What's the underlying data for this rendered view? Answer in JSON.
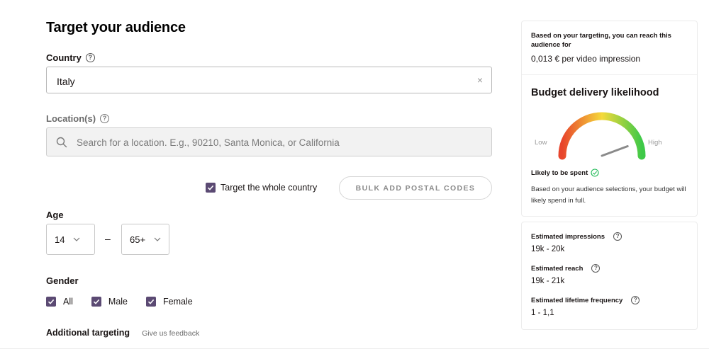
{
  "page": {
    "title": "Target your audience"
  },
  "country": {
    "label": "Country",
    "value": "Italy"
  },
  "location": {
    "label": "Location(s)",
    "placeholder": "Search for a location. E.g., 90210, Santa Monica, or California"
  },
  "whole_country": {
    "label": "Target the whole country",
    "checked": true
  },
  "bulk_button": {
    "label": "BULK ADD POSTAL CODES"
  },
  "age": {
    "label": "Age",
    "min": "14",
    "max": "65+",
    "separator": "–"
  },
  "gender": {
    "label": "Gender",
    "options": [
      {
        "label": "All",
        "checked": true
      },
      {
        "label": "Male",
        "checked": true
      },
      {
        "label": "Female",
        "checked": true
      }
    ]
  },
  "additional": {
    "title": "Additional targeting",
    "link": "Give us feedback"
  },
  "reach_card": {
    "intro": "Based on your targeting, you can reach this audience for",
    "price": "0,013 € per video impression"
  },
  "budget": {
    "title": "Budget delivery likelihood",
    "low_label": "Low",
    "high_label": "High",
    "gauge_level": 0.78,
    "status": "Likely to be spent",
    "description": "Based on your audience selections, your budget will likely spend in full.",
    "status_color": "#1db954"
  },
  "estimates": [
    {
      "label": "Estimated impressions",
      "value": "19k - 20k"
    },
    {
      "label": "Estimated reach",
      "value": "19k - 21k"
    },
    {
      "label": "Estimated lifetime frequency",
      "value": "1 - 1,1"
    }
  ],
  "colors": {
    "checkbox": "#5b4a73",
    "gauge_low": "#e8452c",
    "gauge_mid": "#f5d93a",
    "gauge_high": "#3ec948"
  }
}
